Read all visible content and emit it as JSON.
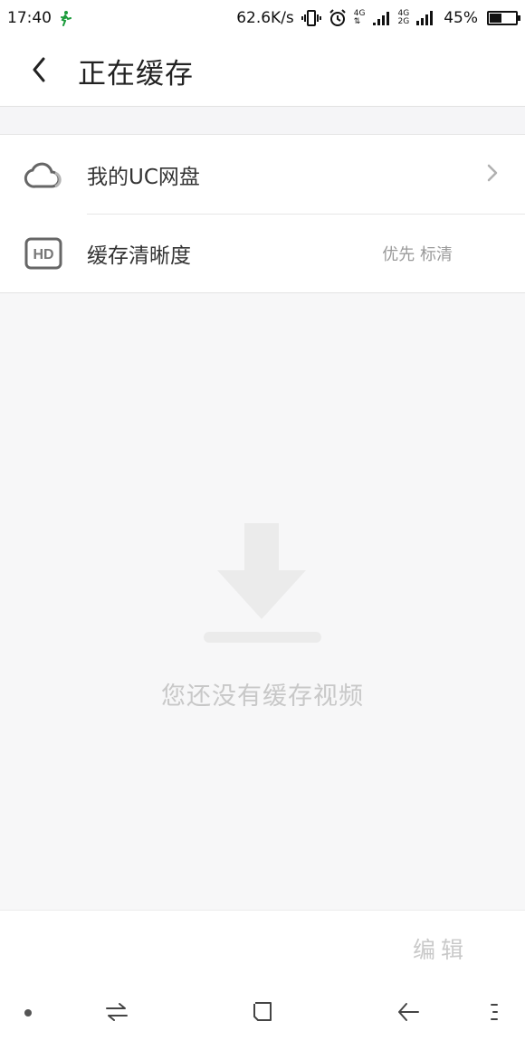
{
  "status_bar": {
    "time": "17:40",
    "net_speed": "62.6K/s",
    "signal_1_top": "4G",
    "signal_2_top": "4G",
    "signal_2_bottom": "2G",
    "battery_percent": "45%",
    "battery_level": 0.45
  },
  "header": {
    "title": "正在缓存",
    "back_icon": "chevron-left-icon"
  },
  "list": {
    "items": [
      {
        "label": "我的UC网盘",
        "icon": "cloud-icon",
        "trailing": "chevron-right-icon"
      },
      {
        "label": "缓存清晰度",
        "icon": "hd-icon",
        "icon_text": "HD",
        "value": "优先 标清"
      }
    ]
  },
  "empty_state": {
    "message": "您还没有缓存视频",
    "icon": "download-icon"
  },
  "edit_bar": {
    "edit_label": "编辑"
  },
  "nav_bar": {
    "items": [
      "dot-icon",
      "switch-icon",
      "home-icon",
      "back-arrow-icon",
      "menu-icon"
    ]
  }
}
